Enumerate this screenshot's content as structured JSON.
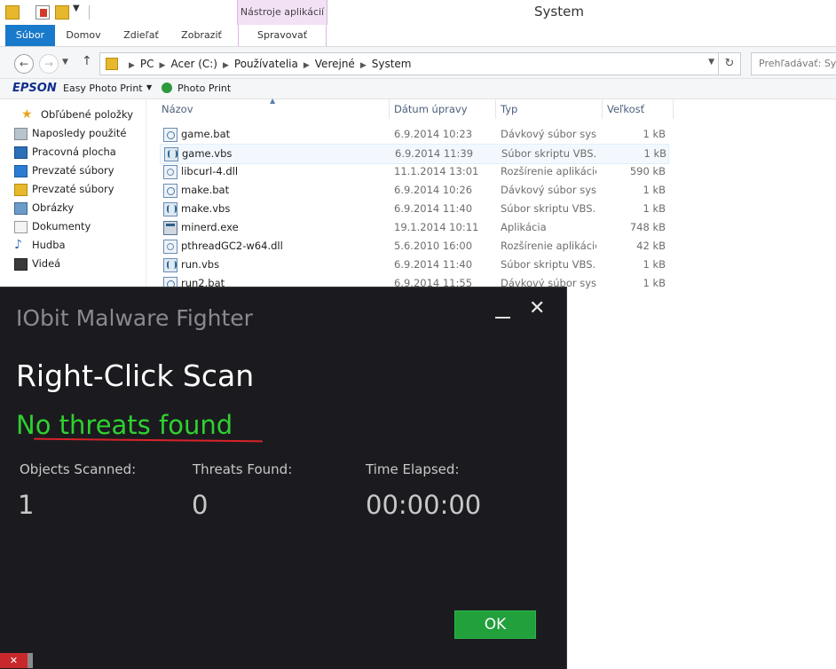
{
  "window": {
    "title": "System",
    "context_tab_group": "Nástroje aplikácií"
  },
  "ribbon": {
    "tabs": [
      "Súbor",
      "Domov",
      "Zdieľať",
      "Zobraziť",
      "Spravovať"
    ]
  },
  "address": {
    "breadcrumb": [
      "PC",
      "Acer (C:)",
      "Používatelia",
      "Verejné",
      "System"
    ],
    "search_placeholder": "Prehľadávať: System"
  },
  "epson_toolbar": {
    "brand": "EPSON",
    "easy_photo_print": "Easy Photo Print",
    "photo_print": "Photo Print"
  },
  "nav": {
    "favorites": "Obľúbené položky",
    "items": [
      "Naposledy použité",
      "Pracovná plocha",
      "Prevzaté súbory",
      "Prevzaté súbory",
      "Obrázky",
      "Dokumenty",
      "Hudba",
      "Videá"
    ]
  },
  "columns": {
    "name": "Názov",
    "date": "Dátum úpravy",
    "type": "Typ",
    "size": "Veľkosť"
  },
  "files": [
    {
      "name": "game.bat",
      "date": "6.9.2014 10:23",
      "type": "Dávkový súbor sys...",
      "size": "1 kB",
      "icon": "batch-file-icon"
    },
    {
      "name": "game.vbs",
      "date": "6.9.2014 11:39",
      "type": "Súbor skriptu VBS...",
      "size": "1 kB",
      "icon": "vbs-script-icon"
    },
    {
      "name": "libcurl-4.dll",
      "date": "11.1.2014 13:01",
      "type": "Rozšírenie aplikácie",
      "size": "590 kB",
      "icon": "dll-file-icon"
    },
    {
      "name": "make.bat",
      "date": "6.9.2014 10:26",
      "type": "Dávkový súbor sys...",
      "size": "1 kB",
      "icon": "batch-file-icon"
    },
    {
      "name": "make.vbs",
      "date": "6.9.2014 11:40",
      "type": "Súbor skriptu VBS...",
      "size": "1 kB",
      "icon": "vbs-script-icon"
    },
    {
      "name": "minerd.exe",
      "date": "19.1.2014 10:11",
      "type": "Aplikácia",
      "size": "748 kB",
      "icon": "exe-file-icon"
    },
    {
      "name": "pthreadGC2-w64.dll",
      "date": "5.6.2010 16:00",
      "type": "Rozšírenie aplikácie",
      "size": "42 kB",
      "icon": "dll-file-icon"
    },
    {
      "name": "run.vbs",
      "date": "6.9.2014 11:40",
      "type": "Súbor skriptu VBS...",
      "size": "1 kB",
      "icon": "vbs-script-icon"
    },
    {
      "name": "run2.bat",
      "date": "6.9.2014 11:55",
      "type": "Dávkový súbor sys...",
      "size": "1 kB",
      "icon": "batch-file-icon"
    }
  ],
  "dialog": {
    "title": "IObit Malware Fighter",
    "heading": "Right-Click Scan",
    "status": "No threats found",
    "stats": [
      {
        "label": "Objects Scanned:",
        "value": "1"
      },
      {
        "label": "Threats Found:",
        "value": "0"
      },
      {
        "label": "Time Elapsed:",
        "value": "00:00:00"
      }
    ],
    "ok_label": "OK",
    "status_color": "#2fd12f",
    "ok_color": "#21a03c"
  },
  "taskbar": {
    "close_glyph": "✕"
  }
}
